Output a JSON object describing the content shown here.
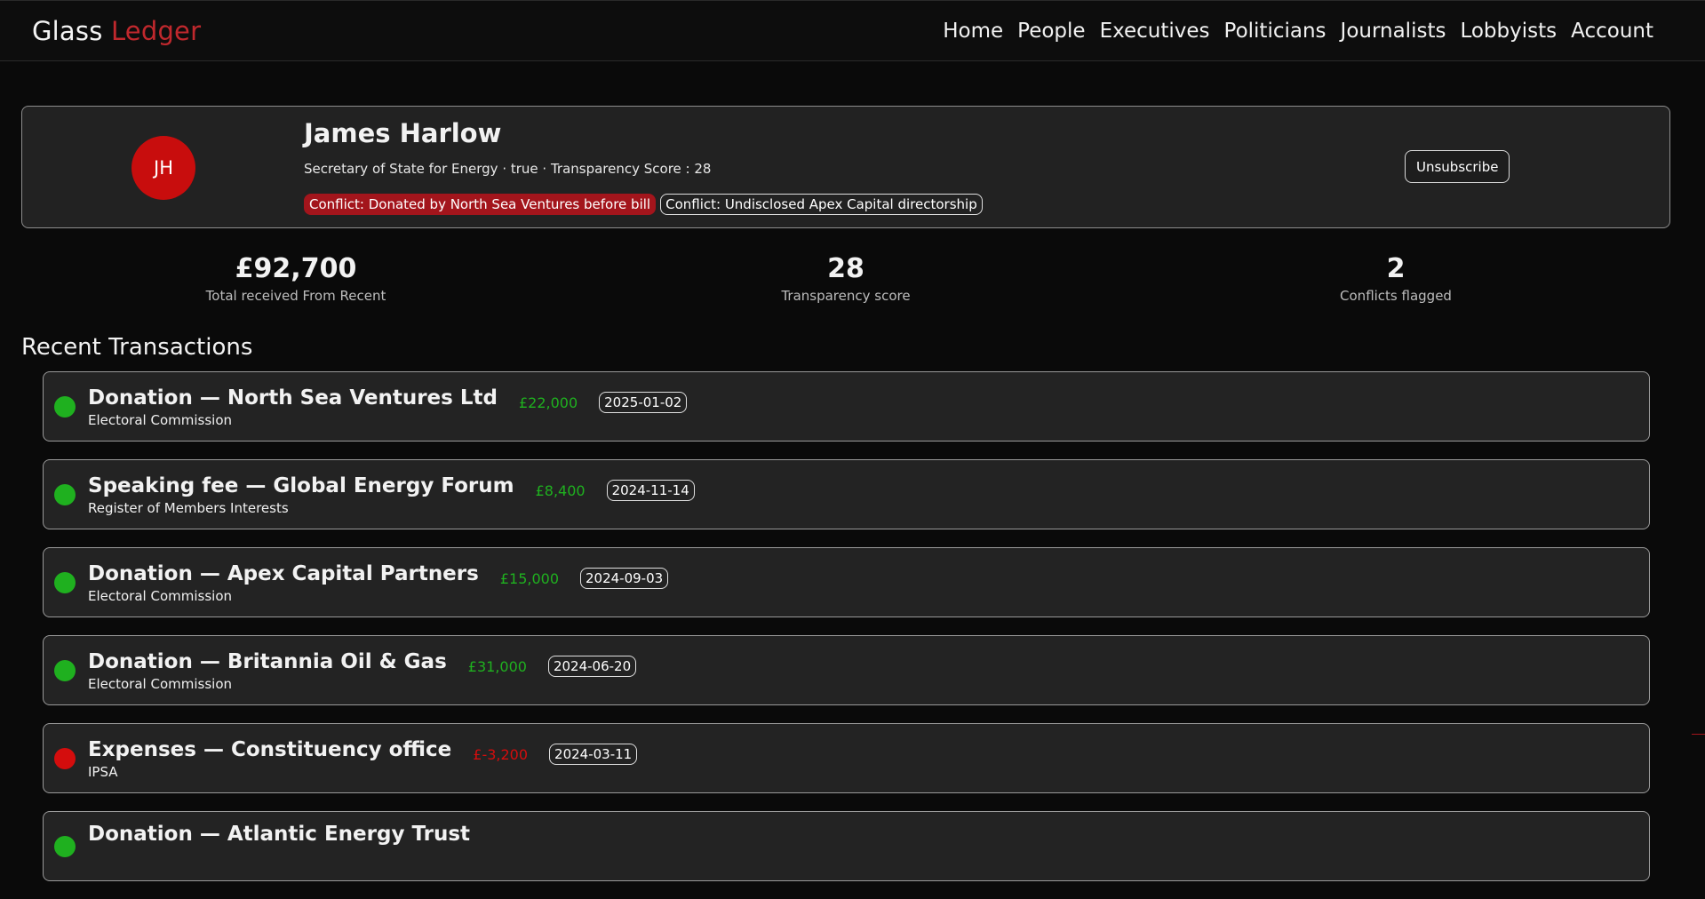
{
  "brand": {
    "part1": "Glass",
    "part2": "Ledger"
  },
  "nav": [
    "Home",
    "People",
    "Executives",
    "Politicians",
    "Journalists",
    "Lobbyists",
    "Account"
  ],
  "profile": {
    "initials": "JH",
    "name": "James Harlow",
    "subtitle": "Secretary of State for Energy · true · Transparency Score : 28",
    "tags": [
      {
        "text": "Conflict: Donated by North Sea Ventures before bill",
        "style": "red"
      },
      {
        "text": "Conflict: Undisclosed Apex Capital directorship",
        "style": "outline"
      }
    ],
    "unsubscribe_label": "Unsubscribe"
  },
  "stats": [
    {
      "value": "£92,700",
      "label": "Total received From Recent"
    },
    {
      "value": "28",
      "label": "Transparency score"
    },
    {
      "value": "2",
      "label": "Conflicts flagged"
    }
  ],
  "section_title": "Recent Transactions",
  "colors": {
    "positive": "#1fb01f",
    "negative": "#d40d0d",
    "accent": "#c0282d"
  },
  "transactions": [
    {
      "title": "Donation — North Sea Ventures Ltd",
      "source": "Electoral Commission",
      "amount": "£22,000",
      "date": "2025-01-02",
      "status": "positive"
    },
    {
      "title": "Speaking fee — Global Energy Forum",
      "source": "Register of Members Interests",
      "amount": "£8,400",
      "date": "2024-11-14",
      "status": "positive"
    },
    {
      "title": "Donation — Apex Capital Partners",
      "source": "Electoral Commission",
      "amount": "£15,000",
      "date": "2024-09-03",
      "status": "positive"
    },
    {
      "title": "Donation — Britannia Oil & Gas",
      "source": "Electoral Commission",
      "amount": "£31,000",
      "date": "2024-06-20",
      "status": "positive"
    },
    {
      "title": "Expenses — Constituency office",
      "source": "IPSA",
      "amount": "£-3,200",
      "date": "2024-03-11",
      "status": "negative"
    },
    {
      "title": "Donation — Atlantic Energy Trust",
      "source": "",
      "amount": "",
      "date": "",
      "status": "positive"
    }
  ]
}
